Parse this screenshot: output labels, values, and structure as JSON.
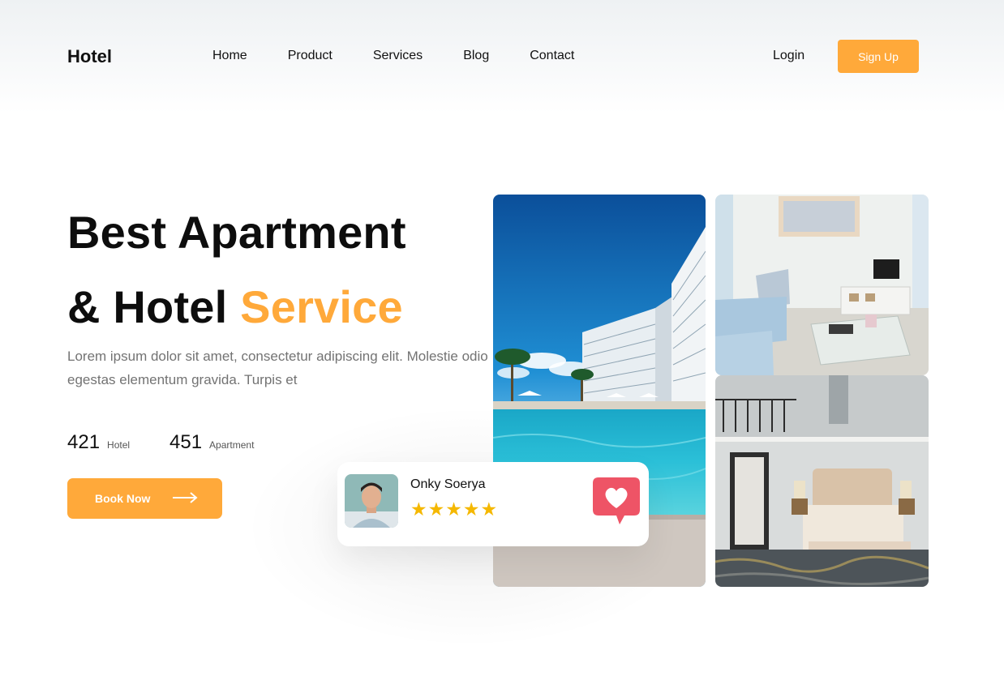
{
  "header": {
    "logo": "Hotel",
    "nav": [
      {
        "label": "Home"
      },
      {
        "label": "Product"
      },
      {
        "label": "Services"
      },
      {
        "label": "Blog"
      },
      {
        "label": "Contact"
      }
    ],
    "login_label": "Login",
    "signup_label": "Sign Up"
  },
  "hero": {
    "title_line1": "Best Apartment",
    "title_line2_prefix": "& Hotel",
    "title_line2_accent": "Service",
    "description": "Lorem ipsum dolor sit amet, consectetur adipiscing elit. Molestie odio egestas elementum gravida. Turpis et",
    "stats": [
      {
        "value": "421",
        "label": "Hotel"
      },
      {
        "value": "451",
        "label": "Apartment"
      }
    ],
    "cta_label": "Book Now"
  },
  "review": {
    "name": "Onky Soerya",
    "rating": 5
  },
  "colors": {
    "accent": "#ffa93a",
    "star": "#f5b800",
    "heart_badge": "#ee5466"
  },
  "icons": {
    "cta": "arrow-right-icon",
    "review_badge": "heart-chat-icon",
    "rating": "star-icon"
  }
}
